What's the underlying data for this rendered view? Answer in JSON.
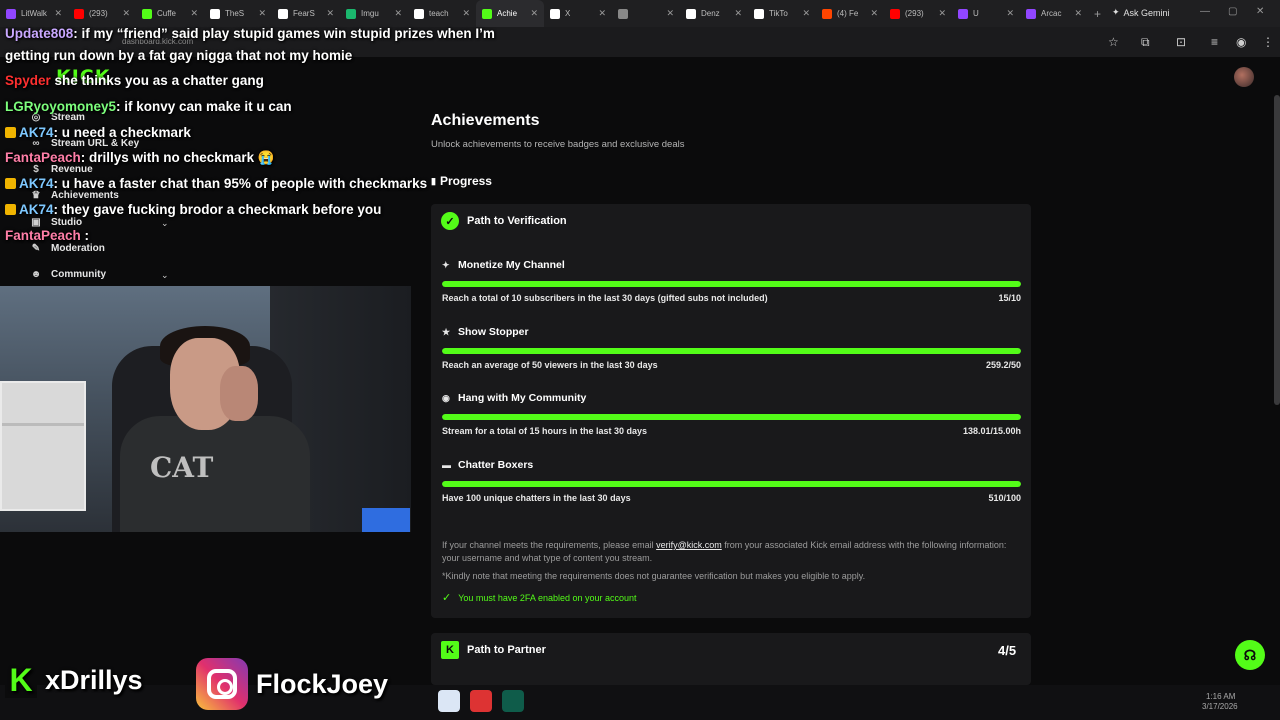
{
  "browser": {
    "tabs": [
      {
        "label": "LitWalk",
        "color": "#9146ff"
      },
      {
        "label": "(293)",
        "color": "#ff0000"
      },
      {
        "label": "Cuffe",
        "color": "#53fc18"
      },
      {
        "label": "TheS",
        "color": "#ffffff"
      },
      {
        "label": "FearS",
        "color": "#ffffff"
      },
      {
        "label": "Imgu",
        "color": "#1bb76e"
      },
      {
        "label": "teach",
        "color": "#ffffff"
      },
      {
        "label": "Achie",
        "color": "#53fc18"
      },
      {
        "label": "X",
        "color": "#ffffff"
      },
      {
        "label": "",
        "color": "#888888"
      },
      {
        "label": "Denz",
        "color": "#ffffff"
      },
      {
        "label": "TikTo",
        "color": "#ffffff"
      },
      {
        "label": "(4) Fe",
        "color": "#ff4500"
      },
      {
        "label": "(293)",
        "color": "#ff0000"
      },
      {
        "label": "U",
        "color": "#9146ff"
      },
      {
        "label": "Arcac",
        "color": "#9146ff"
      }
    ],
    "ask_gemini": "Ask Gemini",
    "url": "dashboard.kick.com"
  },
  "brand": {
    "logo": "KICK",
    "accent": "#53fc18"
  },
  "sidebar": {
    "items": [
      {
        "label": "Stream",
        "icon": "broadcast-icon"
      },
      {
        "label": "Stream URL & Key",
        "icon": "link-icon"
      },
      {
        "label": "Revenue",
        "icon": "dollar-icon"
      },
      {
        "label": "Achievements",
        "icon": "trophy-icon"
      },
      {
        "label": "Studio",
        "icon": "studio-icon"
      },
      {
        "label": "Moderation",
        "icon": "wrench-icon"
      },
      {
        "label": "Community",
        "icon": "people-icon"
      }
    ]
  },
  "chat": [
    {
      "name": "Update808",
      "name_color": "#c9a8ff",
      "text": ": if my “friend” said play stupid games win stupid prizes when I’m"
    },
    {
      "name": "",
      "name_color": "#ffffff",
      "text": "getting run down by a fat gay nigga that not my homie"
    },
    {
      "name": "Spyder",
      "name_color": "#ff3030",
      "text": " she thinks you as a chatter gang"
    },
    {
      "name": "LGRyoyomoney5",
      "name_color": "#7dff7d",
      "text": ": if konvy can make it u can"
    },
    {
      "name": "AK74",
      "name_color": "#7ec8ff",
      "text": ": u need a checkmark"
    },
    {
      "name": "FantaPeach",
      "name_color": "#ff7fa8",
      "text": ": drillys with no checkmark 😭"
    },
    {
      "name": "AK74",
      "name_color": "#7ec8ff",
      "text": ": u have a faster chat than 95% of people with checkmarks"
    },
    {
      "name": "AK74",
      "name_color": "#7ec8ff",
      "text": ": they gave fucking brodor a checkmark before you"
    },
    {
      "name": "FantaPeach",
      "name_color": "#ff7fa8",
      "text": " :"
    }
  ],
  "main": {
    "title": "Achievements",
    "subtitle": "Unlock achievements to receive badges and exclusive deals",
    "progress_label": "Progress",
    "verification": {
      "title": "Path to Verification",
      "requirements": [
        {
          "title": "Monetize My Channel",
          "icon": "sparkle-icon",
          "desc": "Reach a total of 10 subscribers in the last 30 days (gifted subs not included)",
          "value": "15/10",
          "progress": 1.0
        },
        {
          "title": "Show Stopper",
          "icon": "star-icon",
          "desc": "Reach an average of 50 viewers in the last 30 days",
          "value": "259.2/50",
          "progress": 1.0
        },
        {
          "title": "Hang with My Community",
          "icon": "broadcast-icon",
          "desc": "Stream for a total of 15 hours in the last 30 days",
          "value": "138.01/15.00h",
          "progress": 1.0
        },
        {
          "title": "Chatter Boxers",
          "icon": "chat-icon",
          "desc": "Have 100 unique chatters in the last 30 days",
          "value": "510/100",
          "progress": 1.0
        }
      ],
      "note_pre": "If your channel meets the requirements, please email ",
      "note_email": "verify@kick.com",
      "note_post": " from your associated Kick email address with the following information: your username and what type of content you stream.",
      "disclaimer": "*Kindly note that meeting the requirements does not guarantee verification but makes you eligible to apply.",
      "twofa": "You must have 2FA enabled on your account"
    },
    "partner": {
      "title": "Path to Partner",
      "count": "4/5"
    }
  },
  "overlay": {
    "kick_handle": "xDrillys",
    "ig_handle": "FlockJoey",
    "cam_shirt": "CAT"
  },
  "taskbar": {
    "time": "1:16 AM",
    "date": "3/17/2026"
  }
}
